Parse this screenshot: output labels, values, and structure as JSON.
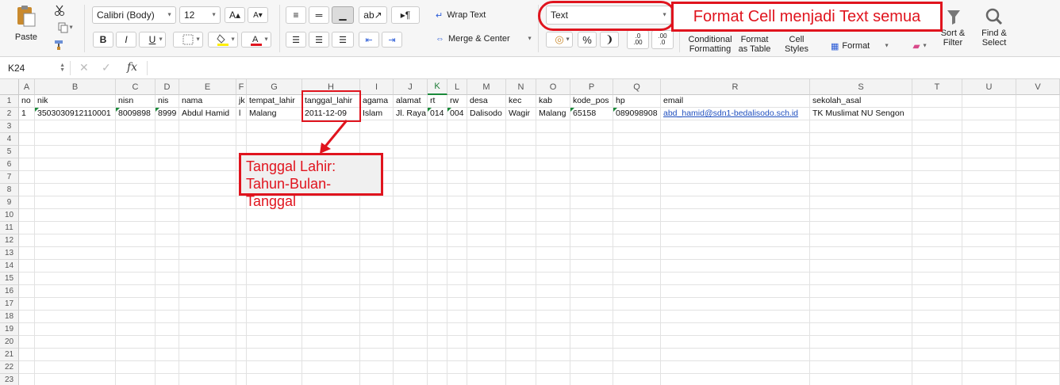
{
  "ribbon": {
    "paste_label": "Paste",
    "font_name": "Calibri (Body)",
    "font_size": "12",
    "bold": "B",
    "italic": "I",
    "underline": "U",
    "wrap_text": "Wrap Text",
    "merge_center": "Merge & Center",
    "number_format": "Text",
    "percent": "%",
    "comma": "❩",
    "inc_decimal": ".0\n.00",
    "dec_decimal": ".00\n.0",
    "conditional_formatting": "Conditional Formatting",
    "format_as_table": "Format as Table",
    "cell_styles": "Cell Styles",
    "format": "Format",
    "sort_filter": "Sort & Filter",
    "find_select": "Find & Select"
  },
  "formula_bar": {
    "name_box": "K24",
    "fx": "fx",
    "value": ""
  },
  "columns": [
    "A",
    "B",
    "C",
    "D",
    "E",
    "F",
    "G",
    "H",
    "I",
    "J",
    "K",
    "L",
    "M",
    "N",
    "O",
    "P",
    "Q",
    "R",
    "S",
    "T",
    "U",
    "V"
  ],
  "rows": [
    "1",
    "2",
    "3",
    "4",
    "5",
    "6",
    "7",
    "8",
    "9",
    "10",
    "11",
    "12",
    "13",
    "14",
    "15",
    "16",
    "17",
    "18",
    "19",
    "20",
    "21",
    "22",
    "23"
  ],
  "sheet": {
    "headers": [
      "no",
      "nik",
      "nisn",
      "nis",
      "nama",
      "jk",
      "tempat_lahir",
      "tanggal_lahir",
      "agama",
      "alamat",
      "rt",
      "rw",
      "desa",
      "kec",
      "kab",
      "kode_pos",
      "hp",
      "email",
      "sekolah_asal"
    ],
    "row2": [
      "1",
      "3503030912110001",
      "8009898",
      "8999",
      "Abdul Hamid",
      "l",
      "Malang",
      "2011-12-09",
      "Islam",
      "Jl. Raya",
      "014",
      "004",
      "Dalisodo",
      "Wagir",
      "Malang",
      "65158",
      "089098908",
      "abd_hamid@sdn1-bedalisodo.sch.id",
      "TK Muslimat NU Sengon"
    ]
  },
  "annotations": {
    "format_note": "Format Cell menjadi Text semua",
    "date_note_line1": "Tanggal Lahir:",
    "date_note_line2": "Tahun-Bulan-Tanggal"
  },
  "colors": {
    "annotation_red": "#e0141e",
    "text_indicator_green": "#1b8a3a",
    "link_blue": "#1f4fbf"
  }
}
